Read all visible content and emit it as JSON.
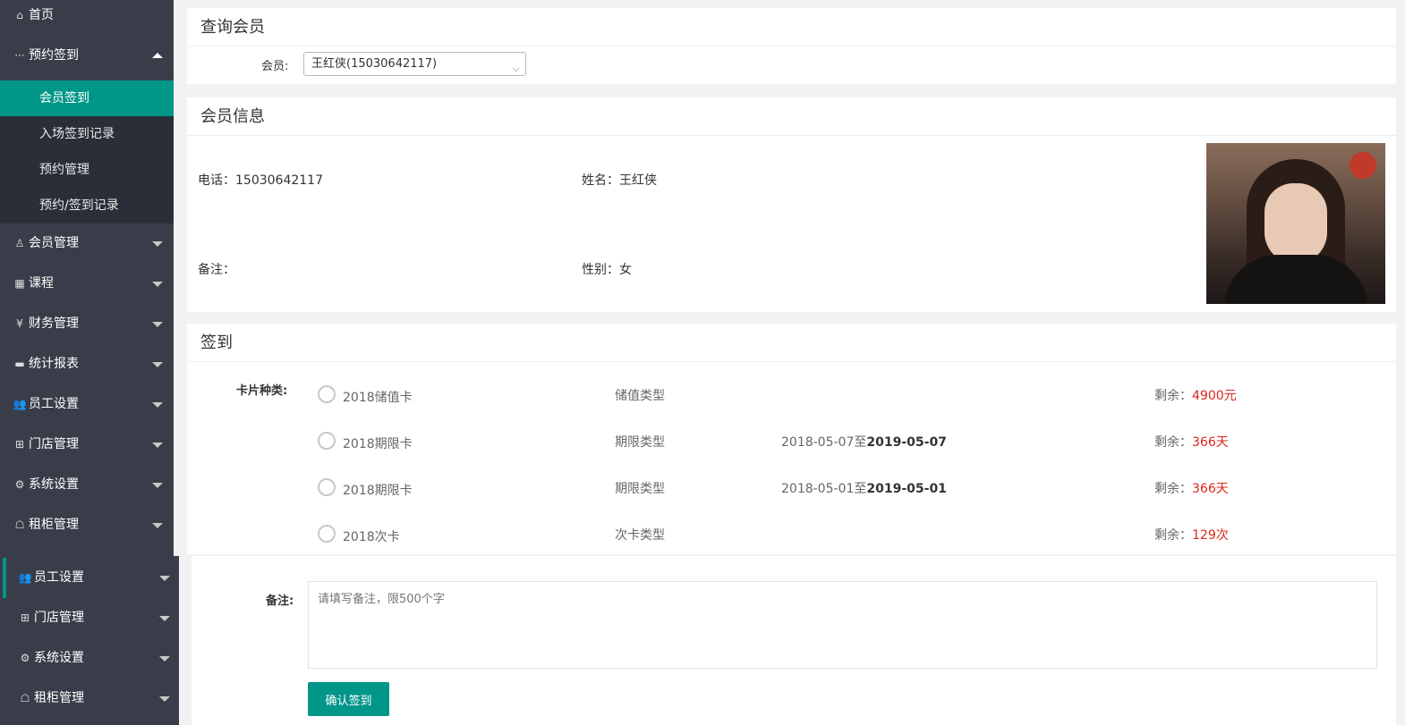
{
  "sidebar": {
    "home": "首页",
    "group_checkin": "预约签到",
    "children": [
      "会员签到",
      "入场签到记录",
      "预约管理",
      "预约/签到记录"
    ],
    "items": [
      {
        "label": "会员管理",
        "icon": "user-icon"
      },
      {
        "label": "课程",
        "icon": "grid-icon"
      },
      {
        "label": "财务管理",
        "icon": "yen-icon"
      },
      {
        "label": "统计报表",
        "icon": "report-icon"
      },
      {
        "label": "员工设置",
        "icon": "staff-icon"
      },
      {
        "label": "门店管理",
        "icon": "store-icon"
      },
      {
        "label": "系统设置",
        "icon": "gear-icon"
      },
      {
        "label": "租柜管理",
        "icon": "locker-icon"
      }
    ]
  },
  "sidebar_bottom": {
    "items": [
      "员工设置",
      "门店管理",
      "系统设置",
      "租柜管理"
    ]
  },
  "query": {
    "title": "查询会员",
    "member_label": "会员:",
    "member_value": "王红侠(15030642117)"
  },
  "member_info": {
    "title": "会员信息",
    "phone": "电话：15030642117",
    "name": "姓名：王红侠",
    "remark": "备注：",
    "gender": "性别：女"
  },
  "checkin": {
    "title": "签到",
    "card_type_label": "卡片种类:",
    "cards": [
      {
        "name": "2018储值卡",
        "type": "储值类型",
        "start": "",
        "end": "",
        "remain_label": "剩余：",
        "remain_value": "4900元"
      },
      {
        "name": "2018期限卡",
        "type": "期限类型",
        "start": "2018-05-07至",
        "end": "2019-05-07",
        "remain_label": "剩余：",
        "remain_value": "366天"
      },
      {
        "name": "2018期限卡",
        "type": "期限类型",
        "start": "2018-05-01至",
        "end": "2019-05-01",
        "remain_label": "剩余：",
        "remain_value": "366天"
      },
      {
        "name": "2018次卡",
        "type": "次卡类型",
        "start": "",
        "end": "",
        "remain_label": "剩余：",
        "remain_value": "129次"
      }
    ],
    "remark_label": "备注:",
    "remark_placeholder": "请填写备注，限500个字",
    "confirm_button": "确认签到"
  },
  "colors": {
    "accent": "#009688",
    "sidebar": "#393d49",
    "remain": "#d9251c"
  }
}
